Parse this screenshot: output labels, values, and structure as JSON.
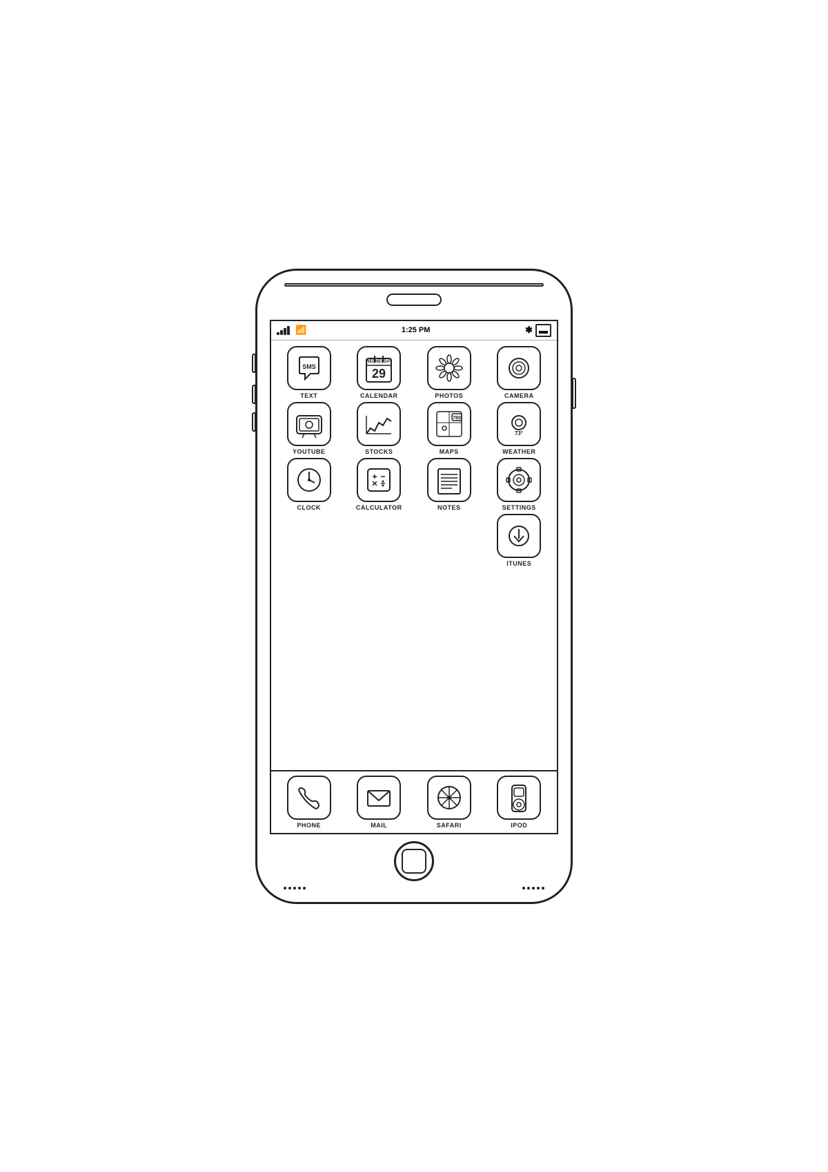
{
  "phone": {
    "status": {
      "time": "1:25 PM"
    },
    "apps": [
      {
        "id": "text",
        "label": "TEXT"
      },
      {
        "id": "calendar",
        "label": "CALENDAR",
        "day": "29",
        "weekday": "WEDNESDAY"
      },
      {
        "id": "photos",
        "label": "PHOTOS"
      },
      {
        "id": "camera",
        "label": "CAMERA"
      },
      {
        "id": "youtube",
        "label": "YOUTUBE"
      },
      {
        "id": "stocks",
        "label": "STOCKS"
      },
      {
        "id": "maps",
        "label": "MAPS"
      },
      {
        "id": "weather",
        "label": "WEATHER",
        "temp": "73°"
      },
      {
        "id": "clock",
        "label": "CLOCK"
      },
      {
        "id": "calculator",
        "label": "CALCULATOR"
      },
      {
        "id": "notes",
        "label": "NOTES"
      },
      {
        "id": "settings",
        "label": "SETTINGS"
      },
      {
        "id": "itunes",
        "label": "ITUNES"
      }
    ],
    "dock": [
      {
        "id": "phone",
        "label": "PHONE"
      },
      {
        "id": "mail",
        "label": "MAIL"
      },
      {
        "id": "safari",
        "label": "SAFARI"
      },
      {
        "id": "ipod",
        "label": "IPOD"
      }
    ]
  }
}
